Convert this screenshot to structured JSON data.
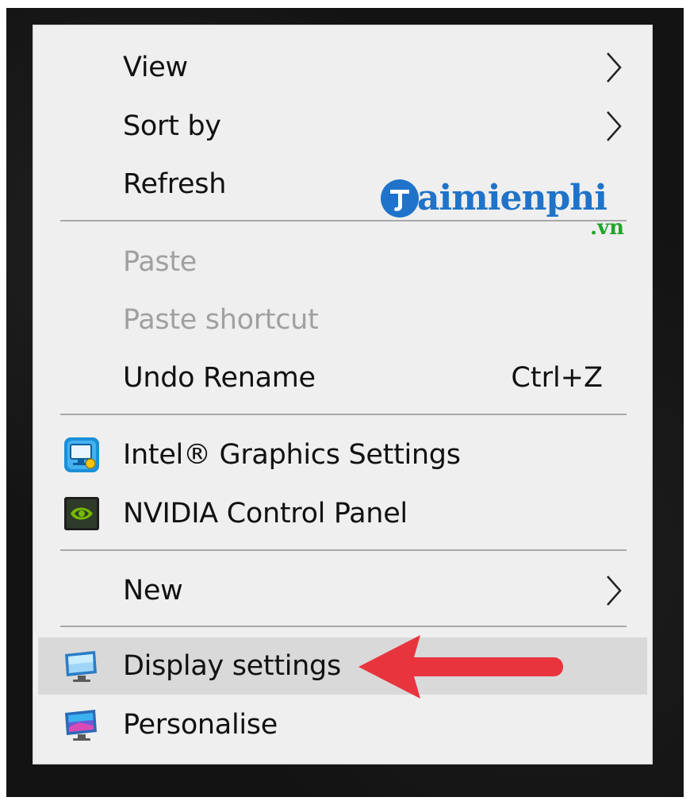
{
  "menu": {
    "view": {
      "label": "View",
      "has_submenu": true
    },
    "sort_by": {
      "label": "Sort by",
      "has_submenu": true
    },
    "refresh": {
      "label": "Refresh"
    },
    "paste": {
      "label": "Paste",
      "disabled": true
    },
    "paste_shortcut": {
      "label": "Paste shortcut",
      "disabled": true
    },
    "undo_rename": {
      "label": "Undo Rename",
      "shortcut": "Ctrl+Z"
    },
    "intel_graphics": {
      "label": "Intel® Graphics Settings",
      "icon": "intel-graphics-icon"
    },
    "nvidia_panel": {
      "label": "NVIDIA Control Panel",
      "icon": "nvidia-icon"
    },
    "new": {
      "label": "New",
      "has_submenu": true
    },
    "display_settings": {
      "label": "Display settings",
      "icon": "display-icon",
      "highlighted": true
    },
    "personalise": {
      "label": "Personalise",
      "icon": "personalise-icon"
    }
  },
  "watermark": {
    "text": "aimienphi",
    "suffix": ".vn"
  },
  "colors": {
    "menu_bg": "#efefef",
    "highlight": "#d9d9d9",
    "disabled_text": "#a0a0a0",
    "arrow": "#e8353d",
    "watermark_blue": "#1f73c9",
    "watermark_green": "#20a52a"
  }
}
